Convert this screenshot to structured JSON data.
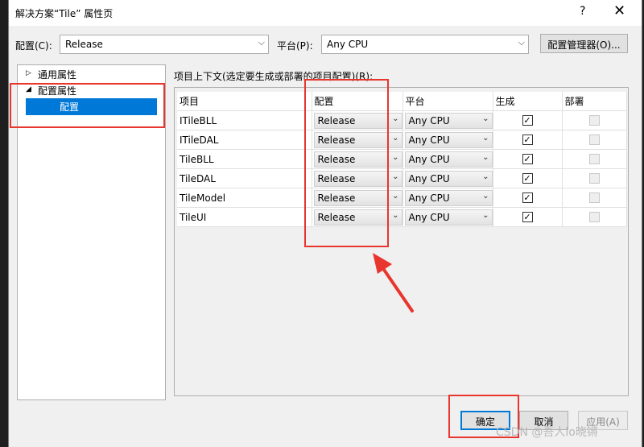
{
  "window": {
    "title": "解决方案“Tile” 属性页",
    "help_label": "?",
    "close_label": "✕"
  },
  "toolbar": {
    "config_label": "配置(C):",
    "config_value": "Release",
    "platform_label": "平台(P):",
    "platform_value": "Any CPU",
    "config_manager_label": "配置管理器(O)..."
  },
  "tree": {
    "items": [
      {
        "label": "通用属性",
        "expander": "▷"
      },
      {
        "label": "配置属性",
        "expander": "◢"
      },
      {
        "label": "配置",
        "selected": true
      }
    ]
  },
  "context_label": "项目上下文(选定要生成或部署的项目配置)(R):",
  "grid": {
    "columns": [
      "项目",
      "配置",
      "平台",
      "生成",
      "部署"
    ],
    "rows": [
      {
        "project": "ITileBLL",
        "config": "Release",
        "platform": "Any CPU",
        "build": true,
        "deploy": false
      },
      {
        "project": "ITileDAL",
        "config": "Release",
        "platform": "Any CPU",
        "build": true,
        "deploy": false
      },
      {
        "project": "TileBLL",
        "config": "Release",
        "platform": "Any CPU",
        "build": true,
        "deploy": false
      },
      {
        "project": "TileDAL",
        "config": "Release",
        "platform": "Any CPU",
        "build": true,
        "deploy": false
      },
      {
        "project": "TileModel",
        "config": "Release",
        "platform": "Any CPU",
        "build": true,
        "deploy": false
      },
      {
        "project": "TileUI",
        "config": "Release",
        "platform": "Any CPU",
        "build": true,
        "deploy": false
      }
    ]
  },
  "buttons": {
    "ok": "确定",
    "cancel": "取消",
    "apply": "应用(A)"
  },
  "watermark": "CSDN @吾人lo晓锵",
  "colors": {
    "accent": "#0078d7",
    "annotation": "#e8352e"
  },
  "icons": {
    "dropdown": "chevron-down-icon",
    "checked": "checkmark-icon"
  }
}
